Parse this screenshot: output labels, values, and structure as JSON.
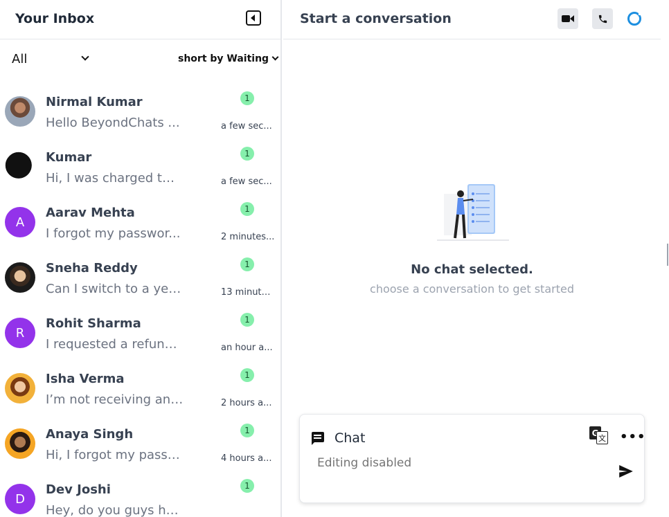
{
  "inbox": {
    "title": "Your Inbox",
    "filter_label": "All",
    "sort_label": "short by Waiting",
    "conversations": [
      {
        "name": "Nirmal Kumar",
        "preview": "Hello BeyondChats ...",
        "time": "a few sec...",
        "unread": "1",
        "avatar": "photo1",
        "initial": ""
      },
      {
        "name": "Kumar",
        "preview": "Hi, I was charged twi...",
        "time": "a few sec...",
        "unread": "1",
        "avatar": "photo2",
        "initial": ""
      },
      {
        "name": "Aarav Mehta",
        "preview": "I forgot my passwor...",
        "time": "2 minutes...",
        "unread": "1",
        "avatar": "letter",
        "initial": "A"
      },
      {
        "name": "Sneha Reddy",
        "preview": "Can I switch to a yea...",
        "time": "13 minute...",
        "unread": "1",
        "avatar": "photo3",
        "initial": ""
      },
      {
        "name": "Rohit Sharma",
        "preview": "I requested a refund ...",
        "time": "an hour a...",
        "unread": "1",
        "avatar": "letter",
        "initial": "R"
      },
      {
        "name": "Isha Verma",
        "preview": "I’m not receiving any...",
        "time": "2 hours a...",
        "unread": "1",
        "avatar": "photo4",
        "initial": ""
      },
      {
        "name": "Anaya Singh",
        "preview": "Hi, I forgot my passw...",
        "time": "4 hours a...",
        "unread": "1",
        "avatar": "photo5",
        "initial": ""
      },
      {
        "name": "Dev Joshi",
        "preview": "Hey, do you guys ha...",
        "time": "",
        "unread": "1",
        "avatar": "letter",
        "initial": "D"
      }
    ]
  },
  "chat": {
    "title": "Start a conversation",
    "empty_title": "No chat selected.",
    "empty_subtitle": "choose a conversation to get started",
    "composer": {
      "label": "Chat",
      "placeholder": "Editing disabled"
    }
  },
  "colors": {
    "accent": "#9333ea",
    "badge": "#86efac",
    "refresh": "#1d8fe0"
  },
  "icons": [
    "collapse-sidebar-icon",
    "video-icon",
    "phone-icon",
    "refresh-icon",
    "chat-icon",
    "translate-icon",
    "more-icon",
    "send-icon"
  ]
}
